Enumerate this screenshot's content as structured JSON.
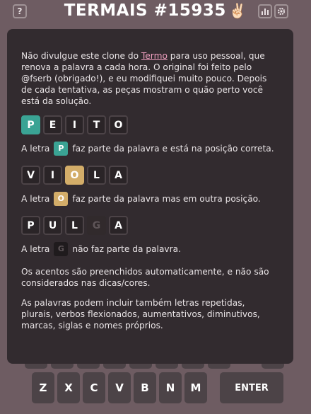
{
  "header": {
    "help_icon": "?",
    "title": "TERMAIS #15935",
    "title_emoji": "✌🏻",
    "stats_icon": "bar-chart",
    "settings_icon": "gear"
  },
  "modal": {
    "intro_before": "Não divulgue este clone do ",
    "intro_link": "Termo",
    "intro_after": " para uso pessoal, que renova a palavra a cada hora. O original foi feito pelo @fserb (obrigado!), e eu modifiquei muito pouco. Depois de cada tentativa, as peças mostram o quão perto você está da solução.",
    "example1": {
      "letters": [
        "P",
        "E",
        "I",
        "T",
        "O"
      ],
      "states": [
        "right",
        "empty",
        "empty",
        "empty",
        "empty"
      ],
      "text_before": "A letra",
      "highlight": "P",
      "text_after": "faz parte da palavra e está na posição correta."
    },
    "example2": {
      "letters": [
        "V",
        "I",
        "O",
        "L",
        "A"
      ],
      "states": [
        "empty",
        "empty",
        "place",
        "empty",
        "empty"
      ],
      "text_before": "A letra",
      "highlight": "O",
      "text_after": "faz parte da palavra mas em outra posição."
    },
    "example3": {
      "letters": [
        "P",
        "U",
        "L",
        "G",
        "A"
      ],
      "states": [
        "empty",
        "empty",
        "empty",
        "wrong",
        "empty"
      ],
      "text_before": "A letra",
      "highlight": "G",
      "text_after": "não faz parte da palavra."
    },
    "accents_note": "Os acentos são preenchidos automaticamente, e não são considerados nas dicas/cores.",
    "words_note": "As palavras podem incluir também letras repetidas, plurais, verbos flexionados, aumentativos, diminutivos, marcas, siglas e nomes próprios."
  },
  "keyboard": {
    "bottom_row": [
      "Z",
      "X",
      "C",
      "V",
      "B",
      "N",
      "M"
    ],
    "enter_label": "ENTER"
  },
  "colors": {
    "background": "#6e5c62",
    "modal": "#322b2f",
    "right": "#3aa394",
    "place": "#d3ad69",
    "wrong": "#312a2c"
  }
}
